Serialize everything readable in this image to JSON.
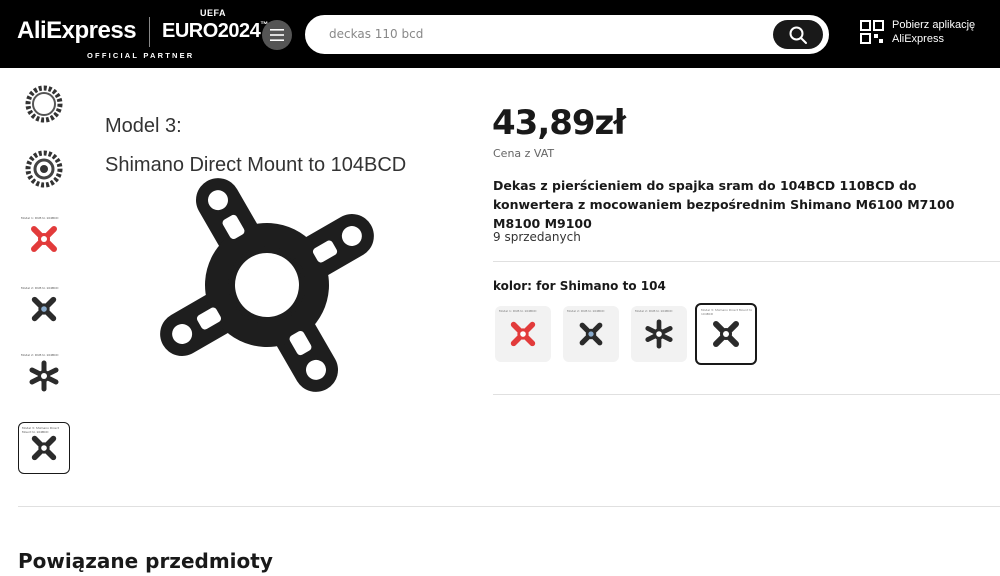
{
  "header": {
    "logo": "AliExpress",
    "euro": "EURO2024",
    "uefa": "UEFA",
    "official_partner": "OFFICIAL PARTNER",
    "search_value": "deckas 110 bcd",
    "app_download_line1": "Pobierz aplikację",
    "app_download_line2": "AliExpress"
  },
  "gallery": {
    "image_caption_line1": "Model 3:",
    "image_caption_line2": "Shimano Direct Mount to 104BCD",
    "thumbnails": [
      {
        "icon": "chainring-icon"
      },
      {
        "icon": "chainring-icon"
      },
      {
        "icon": "spider-red-icon",
        "caption": "Model 1: DUB to 104BCD"
      },
      {
        "icon": "spider-black-icon",
        "caption": "Model 2: DUB to 104BCD"
      },
      {
        "icon": "spider-black-icon",
        "caption": "Model 2: DUB to 104BCD"
      },
      {
        "icon": "spider-black-icon",
        "caption": "Model 3: Shimano Direct Mount to 104BCD"
      }
    ]
  },
  "product": {
    "price": "43,89zł",
    "vat_note": "Cena z VAT",
    "title": "Dekas z pierścieniem do spajka sram do 104BCD 110BCD do konwertera z mocowaniem bezpośrednim Shimano M6100 M7100 M8100 M9100",
    "sold": "9 sprzedanych",
    "color_label": "kolor: for Shimano to 104",
    "swatches": [
      {
        "color": "#e23b3b",
        "caption": "Model 1: DUB to 104BCD"
      },
      {
        "color": "#2b2b2b",
        "caption": "Model 2: DUB to 104BCD"
      },
      {
        "color": "#2b2b2b",
        "caption": "Model 2: DUB to 104BCD"
      },
      {
        "color": "#2b2b2b",
        "caption": "Model 3: Shimano Direct Mount to 104BCD"
      }
    ]
  },
  "related": {
    "heading": "Powiązane przedmioty"
  }
}
